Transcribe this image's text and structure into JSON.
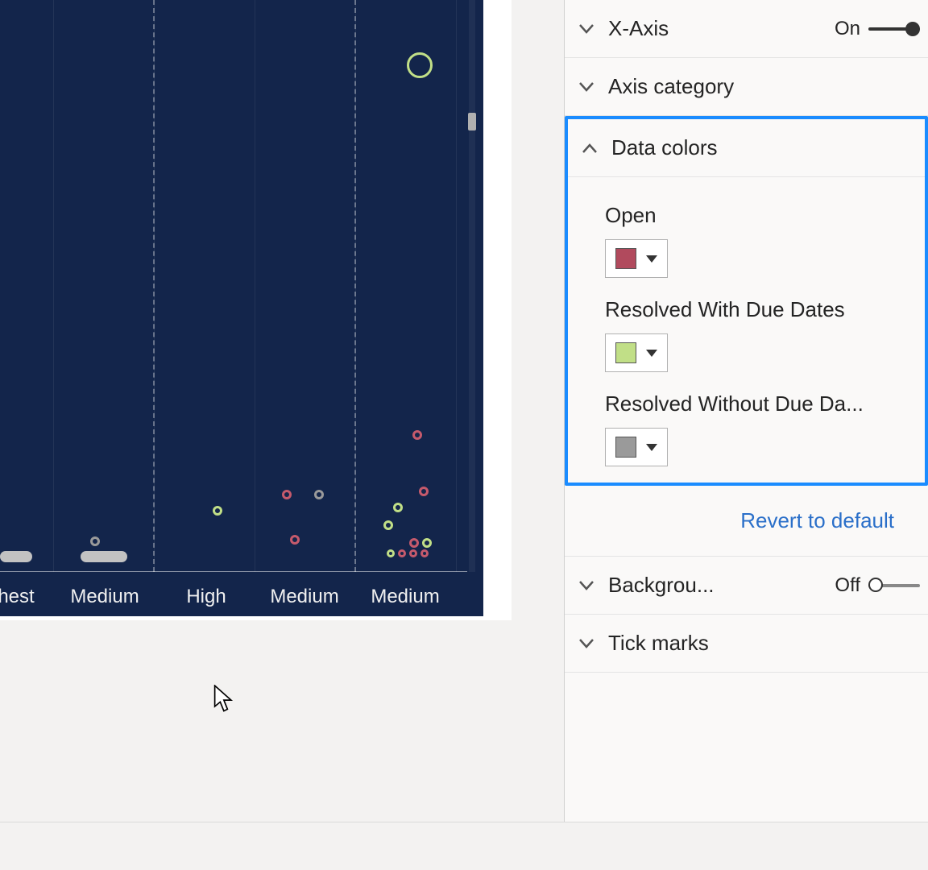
{
  "chart_data": {
    "type": "scatter",
    "title": "",
    "xlabel": "",
    "ylabel": "",
    "categories": [
      "hest",
      "Medium",
      "High",
      "Medium",
      "Medium"
    ],
    "series": [
      {
        "name": "Open",
        "color": "#c55a6c"
      },
      {
        "name": "Resolved With Due Dates",
        "color": "#c1df87"
      },
      {
        "name": "Resolved Without Due Dates",
        "color": "#9a9a9a"
      }
    ],
    "ylim": [
      0,
      100
    ],
    "points": [
      {
        "cat": 4,
        "y": 92,
        "series": "Resolved With Due Dates",
        "size": 28
      },
      {
        "cat": 4,
        "y": 24,
        "series": "Open",
        "size": 8
      },
      {
        "cat": 4,
        "y": 15,
        "series": "Open",
        "size": 8
      },
      {
        "cat": 4,
        "y": 9,
        "series": "Resolved With Due Dates",
        "size": 8
      },
      {
        "cat": 4,
        "y": 6,
        "series": "Resolved With Due Dates",
        "size": 8
      },
      {
        "cat": 4,
        "y": 3,
        "series": "Resolved With Due Dates",
        "size": 8
      },
      {
        "cat": 4,
        "y": 3,
        "series": "Open",
        "size": 8
      },
      {
        "cat": 4,
        "y": 2,
        "series": "Open",
        "size": 8
      },
      {
        "cat": 3,
        "y": 13,
        "series": "Open",
        "size": 8
      },
      {
        "cat": 3,
        "y": 13,
        "series": "Resolved Without Due Dates",
        "size": 8
      },
      {
        "cat": 3,
        "y": 5,
        "series": "Open",
        "size": 8
      },
      {
        "cat": 2,
        "y": 11,
        "series": "Resolved With Due Dates",
        "size": 8
      },
      {
        "cat": 1,
        "y": 5,
        "series": "Resolved Without Due Dates",
        "size": 8
      }
    ]
  },
  "panel": {
    "xaxis": {
      "label": "X-Axis",
      "state": "On"
    },
    "axisCategory": {
      "label": "Axis category"
    },
    "dataColors": {
      "label": "Data colors",
      "items": [
        {
          "label": "Open",
          "color": "#b14a5d"
        },
        {
          "label": "Resolved With Due Dates",
          "color": "#c1df87"
        },
        {
          "label": "Resolved Without Due Da...",
          "color": "#9a9a9a"
        }
      ],
      "revert": "Revert to default"
    },
    "background": {
      "label": "Backgrou...",
      "state": "Off"
    },
    "tickMarks": {
      "label": "Tick marks"
    }
  }
}
